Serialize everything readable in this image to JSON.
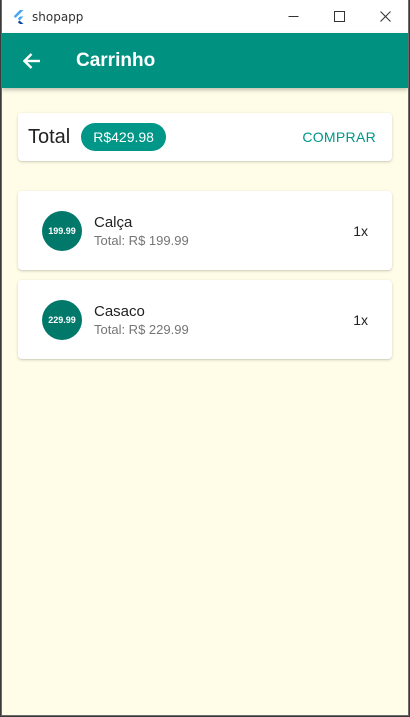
{
  "window": {
    "title": "shopapp"
  },
  "appbar": {
    "title": "Carrinho",
    "back_icon": "arrow-back-icon"
  },
  "summary": {
    "total_label": "Total",
    "total_value": "R$429.98",
    "buy_label": "COMPRAR"
  },
  "items": [
    {
      "avatar": "199.99",
      "name": "Calça",
      "subtitle": "Total: R$ 199.99",
      "quantity": "1x"
    },
    {
      "avatar": "229.99",
      "name": "Casaco",
      "subtitle": "Total: R$ 229.99",
      "quantity": "1x"
    }
  ],
  "colors": {
    "primary": "#009181",
    "chip": "#009688",
    "avatar": "#00796b",
    "background": "#fffde7"
  }
}
